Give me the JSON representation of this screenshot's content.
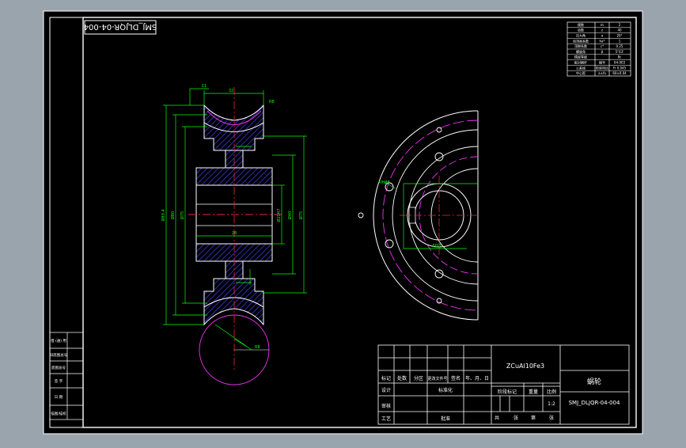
{
  "drawing": {
    "code_stamp": "SMJ_DLJQR-04-004",
    "material": "ZCuAl10Fe3",
    "part_name": "蜗轮",
    "drawing_number": "SMJ_DLJQR-04-004",
    "scale": "1:2"
  },
  "title_block": {
    "row_labels": [
      "标记",
      "处数",
      "分区",
      "更改文件号",
      "签名",
      "年、月、日"
    ],
    "designer": "设计",
    "standardized": "标准化",
    "review": "审核",
    "process": "工艺",
    "approve": "批准",
    "stage_mark": "阶段标记",
    "weight": "重量",
    "ratio": "比例",
    "sheet_total": "共",
    "sheet_unit": "张",
    "sheet_index": "第",
    "sheet_unit2": "张"
  },
  "side_block": {
    "labels": [
      "借 (通) 用",
      "旧底图总号",
      "底图总号",
      "签 字",
      "日 期",
      "描图/描校",
      "档案"
    ]
  },
  "param_table": {
    "rows": [
      [
        "模数",
        "m",
        "2"
      ],
      [
        "齿数",
        "z",
        "40"
      ],
      [
        "压力角",
        "α",
        "20°"
      ],
      [
        "齿顶高系数",
        "ha*",
        "1"
      ],
      [
        "顶隙系数",
        "c*",
        "0.25"
      ],
      [
        "螺旋角",
        "β",
        "5°43'"
      ],
      [
        "精度等级",
        "",
        "8c"
      ],
      [
        "配对蜗杆",
        "图号",
        "04-003"
      ],
      [
        "公差组",
        "检验项目",
        "Fr 0.045"
      ],
      [
        "中心距",
        "a±fa",
        "60±0.04"
      ]
    ]
  },
  "dimensions": {
    "hub_width": "32",
    "bore_len": "28",
    "center": "C1",
    "d_outer": "Ø83.4",
    "d_pitch": "Ø80",
    "d_root": "Ø75",
    "d_hub": "Ø40",
    "d_bore": "Ø20H7",
    "throat_r": "R8",
    "keyway": "6JS9",
    "hole": "4×Ø6"
  }
}
